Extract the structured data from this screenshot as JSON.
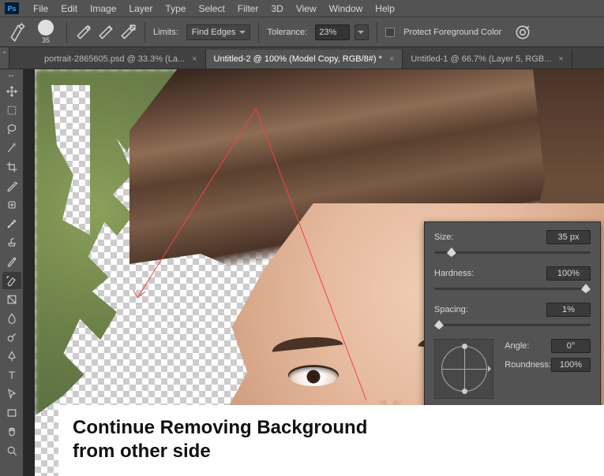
{
  "menu": {
    "items": [
      "File",
      "Edit",
      "Image",
      "Layer",
      "Type",
      "Select",
      "Filter",
      "3D",
      "View",
      "Window",
      "Help"
    ]
  },
  "app": {
    "logo_text": "Ps"
  },
  "options": {
    "brush_size": "35",
    "limits_label": "Limits:",
    "limits_value": "Find Edges",
    "tolerance_label": "Tolerance:",
    "tolerance_value": "23%",
    "protect_label": "Protect Foreground Color"
  },
  "tabs": [
    {
      "label": "portrait-2865605.psd @ 33.3% (La...",
      "active": false
    },
    {
      "label": "Untitled-2 @ 100% (Model Copy, RGB/8#) *",
      "active": true
    },
    {
      "label": "Untitled-1 @ 66.7% (Layer 5, RGB...",
      "active": false
    }
  ],
  "panel": {
    "size_label": "Size:",
    "size_value": "35 px",
    "hardness_label": "Hardness:",
    "hardness_value": "100%",
    "spacing_label": "Spacing:",
    "spacing_value": "1%",
    "angle_label": "Angle:",
    "angle_value": "0°",
    "roundness_label": "Roundness:",
    "roundness_value": "100%"
  },
  "instruction": {
    "line1": "Continue Removing Background",
    "line2": "from other side"
  },
  "tab_close": "×"
}
